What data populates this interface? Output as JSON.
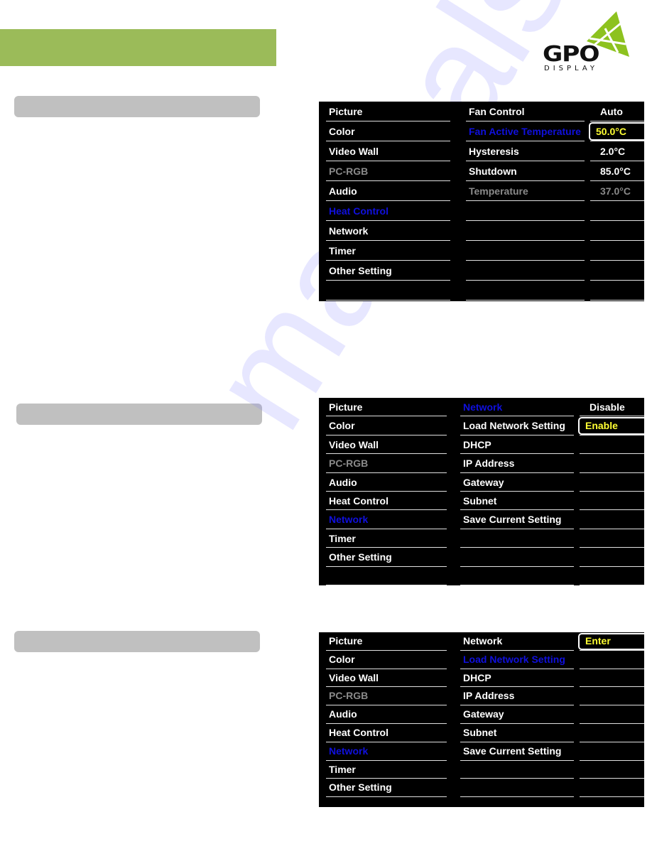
{
  "header": {
    "banner_color": "#9bbb59",
    "logo": {
      "brand": "GPO",
      "sub": "DISPLAY",
      "accent": "#8dc21f"
    }
  },
  "watermark": "manualslive.com",
  "colors": {
    "highlight": "#1010dd",
    "selected_value": "#ffff33",
    "disabled": "#8a8a8a"
  },
  "panels": [
    {
      "main_menu": [
        {
          "label": "Picture",
          "state": "normal"
        },
        {
          "label": "Color",
          "state": "normal"
        },
        {
          "label": "Video Wall",
          "state": "normal"
        },
        {
          "label": "PC-RGB",
          "state": "disabled"
        },
        {
          "label": "Audio",
          "state": "normal"
        },
        {
          "label": "Heat Control",
          "state": "highlighted"
        },
        {
          "label": "Network",
          "state": "normal"
        },
        {
          "label": "Timer",
          "state": "normal"
        },
        {
          "label": "Other Setting",
          "state": "normal"
        },
        {
          "label": "",
          "state": "normal"
        }
      ],
      "sub_menu": [
        {
          "label": "Fan Control",
          "state": "normal"
        },
        {
          "label": "Fan Active Temperature",
          "state": "highlighted"
        },
        {
          "label": "Hysteresis",
          "state": "normal"
        },
        {
          "label": "Shutdown",
          "state": "normal"
        },
        {
          "label": "Temperature",
          "state": "disabled"
        },
        {
          "label": "",
          "state": "normal"
        },
        {
          "label": "",
          "state": "normal"
        },
        {
          "label": "",
          "state": "normal"
        },
        {
          "label": "",
          "state": "normal"
        },
        {
          "label": "",
          "state": "normal"
        }
      ],
      "values": [
        {
          "label": "Auto",
          "state": "normal"
        },
        {
          "label": "50.0°C",
          "state": "selected"
        },
        {
          "label": "2.0°C",
          "state": "normal"
        },
        {
          "label": "85.0°C",
          "state": "normal"
        },
        {
          "label": "37.0°C",
          "state": "disabled"
        },
        {
          "label": "",
          "state": "normal"
        },
        {
          "label": "",
          "state": "normal"
        },
        {
          "label": "",
          "state": "normal"
        },
        {
          "label": "",
          "state": "normal"
        },
        {
          "label": "",
          "state": "normal"
        }
      ]
    },
    {
      "main_menu": [
        {
          "label": "Picture",
          "state": "normal"
        },
        {
          "label": "Color",
          "state": "normal"
        },
        {
          "label": "Video Wall",
          "state": "normal"
        },
        {
          "label": "PC-RGB",
          "state": "disabled"
        },
        {
          "label": "Audio",
          "state": "normal"
        },
        {
          "label": "Heat Control",
          "state": "normal"
        },
        {
          "label": "Network",
          "state": "highlighted"
        },
        {
          "label": "Timer",
          "state": "normal"
        },
        {
          "label": "Other Setting",
          "state": "normal"
        },
        {
          "label": "",
          "state": "normal"
        }
      ],
      "sub_menu": [
        {
          "label": "Network",
          "state": "highlighted"
        },
        {
          "label": "Load Network Setting",
          "state": "normal"
        },
        {
          "label": "DHCP",
          "state": "normal"
        },
        {
          "label": "IP Address",
          "state": "normal"
        },
        {
          "label": "Gateway",
          "state": "normal"
        },
        {
          "label": "Subnet",
          "state": "normal"
        },
        {
          "label": "Save Current Setting",
          "state": "normal"
        },
        {
          "label": "",
          "state": "normal"
        },
        {
          "label": "",
          "state": "normal"
        },
        {
          "label": "",
          "state": "normal"
        }
      ],
      "values": [
        {
          "label": "Disable",
          "state": "normal"
        },
        {
          "label": "Enable",
          "state": "selected"
        },
        {
          "label": "",
          "state": "normal"
        },
        {
          "label": "",
          "state": "normal"
        },
        {
          "label": "",
          "state": "normal"
        },
        {
          "label": "",
          "state": "normal"
        },
        {
          "label": "",
          "state": "normal"
        },
        {
          "label": "",
          "state": "normal"
        },
        {
          "label": "",
          "state": "normal"
        },
        {
          "label": "",
          "state": "normal"
        }
      ]
    },
    {
      "main_menu": [
        {
          "label": "Picture",
          "state": "normal"
        },
        {
          "label": "Color",
          "state": "normal"
        },
        {
          "label": "Video Wall",
          "state": "normal"
        },
        {
          "label": "PC-RGB",
          "state": "disabled"
        },
        {
          "label": "Audio",
          "state": "normal"
        },
        {
          "label": "Heat Control",
          "state": "normal"
        },
        {
          "label": "Network",
          "state": "highlighted"
        },
        {
          "label": "Timer",
          "state": "normal"
        },
        {
          "label": "Other Setting",
          "state": "normal"
        }
      ],
      "sub_menu": [
        {
          "label": "Network",
          "state": "normal"
        },
        {
          "label": "Load Network Setting",
          "state": "highlighted"
        },
        {
          "label": "DHCP",
          "state": "normal"
        },
        {
          "label": "IP Address",
          "state": "normal"
        },
        {
          "label": "Gateway",
          "state": "normal"
        },
        {
          "label": "Subnet",
          "state": "normal"
        },
        {
          "label": "Save Current Setting",
          "state": "normal"
        },
        {
          "label": "",
          "state": "normal"
        },
        {
          "label": "",
          "state": "normal"
        }
      ],
      "values": [
        {
          "label": "Enter",
          "state": "selected"
        },
        {
          "label": "",
          "state": "normal"
        },
        {
          "label": "",
          "state": "normal"
        },
        {
          "label": "",
          "state": "normal"
        },
        {
          "label": "",
          "state": "normal"
        },
        {
          "label": "",
          "state": "normal"
        },
        {
          "label": "",
          "state": "normal"
        },
        {
          "label": "",
          "state": "normal"
        },
        {
          "label": "",
          "state": "normal"
        }
      ]
    }
  ]
}
